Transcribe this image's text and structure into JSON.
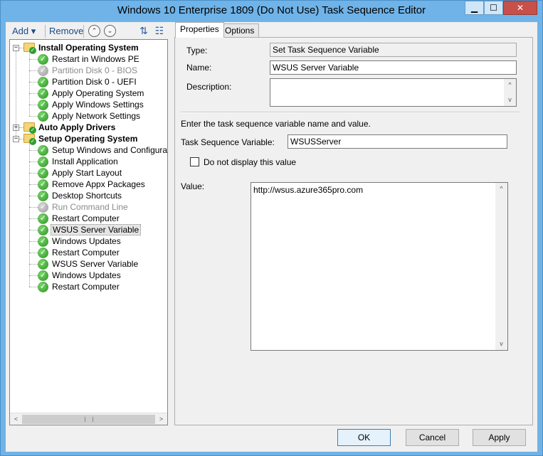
{
  "window": {
    "title": "Windows 10 Enterprise 1809 (Do Not Use) Task Sequence Editor",
    "controls": {
      "minimize": "▁",
      "maximize": "☐",
      "close": "✕"
    }
  },
  "toolbar": {
    "add_label": "Add ▾",
    "remove_label": "Remove",
    "move_up_icon": "⌃",
    "move_down_icon": "⌄"
  },
  "tree": {
    "expander_minus": "−",
    "expander_plus": "+",
    "check_glyph": "✓",
    "nodes": [
      {
        "label": "Install Operating System",
        "level": 0,
        "group": true,
        "expanded": true,
        "disabled": false
      },
      {
        "label": "Restart in Windows PE",
        "level": 1,
        "group": false,
        "disabled": false
      },
      {
        "label": "Partition Disk 0 - BIOS",
        "level": 1,
        "group": false,
        "disabled": true
      },
      {
        "label": "Partition Disk 0 - UEFI",
        "level": 1,
        "group": false,
        "disabled": false
      },
      {
        "label": "Apply Operating System",
        "level": 1,
        "group": false,
        "disabled": false
      },
      {
        "label": "Apply Windows Settings",
        "level": 1,
        "group": false,
        "disabled": false
      },
      {
        "label": "Apply Network Settings",
        "level": 1,
        "group": false,
        "disabled": false
      },
      {
        "label": "Auto Apply Drivers",
        "level": 0,
        "group": true,
        "expanded": false,
        "disabled": false
      },
      {
        "label": "Setup Operating System",
        "level": 0,
        "group": true,
        "expanded": true,
        "disabled": false
      },
      {
        "label": "Setup Windows and Configuration",
        "level": 1,
        "group": false,
        "disabled": false
      },
      {
        "label": "Install Application",
        "level": 1,
        "group": false,
        "disabled": false
      },
      {
        "label": "Apply Start Layout",
        "level": 1,
        "group": false,
        "disabled": false
      },
      {
        "label": "Remove Appx Packages",
        "level": 1,
        "group": false,
        "disabled": false
      },
      {
        "label": "Desktop Shortcuts",
        "level": 1,
        "group": false,
        "disabled": false
      },
      {
        "label": "Run Command Line",
        "level": 1,
        "group": false,
        "disabled": true
      },
      {
        "label": "Restart Computer",
        "level": 1,
        "group": false,
        "disabled": false
      },
      {
        "label": "WSUS Server Variable",
        "level": 1,
        "group": false,
        "disabled": false,
        "selected": true
      },
      {
        "label": "Windows Updates",
        "level": 1,
        "group": false,
        "disabled": false
      },
      {
        "label": "Restart Computer",
        "level": 1,
        "group": false,
        "disabled": false
      },
      {
        "label": "WSUS Server Variable",
        "level": 1,
        "group": false,
        "disabled": false
      },
      {
        "label": "Windows Updates",
        "level": 1,
        "group": false,
        "disabled": false
      },
      {
        "label": "Restart Computer",
        "level": 1,
        "group": false,
        "disabled": false
      }
    ],
    "scroll_left_icon": "<",
    "scroll_right_icon": ">"
  },
  "tabs": [
    {
      "label": "Properties",
      "active": true
    },
    {
      "label": "Options",
      "active": false
    }
  ],
  "properties": {
    "type_label": "Type:",
    "type_value": "Set Task Sequence Variable",
    "name_label": "Name:",
    "name_value": "WSUS Server Variable",
    "description_label": "Description:",
    "description_value": "",
    "instructions": "Enter the task sequence variable name and value.",
    "variable_label": "Task Sequence Variable:",
    "variable_value": "WSUSServer",
    "do_not_display_label": "Do not display this value",
    "do_not_display_checked": false,
    "value_label": "Value:",
    "value_text": "http://wsus.azure365pro.com",
    "scroll_up_icon": "^",
    "scroll_down_icon": "v"
  },
  "buttons": {
    "ok": "OK",
    "cancel": "Cancel",
    "apply": "Apply"
  }
}
